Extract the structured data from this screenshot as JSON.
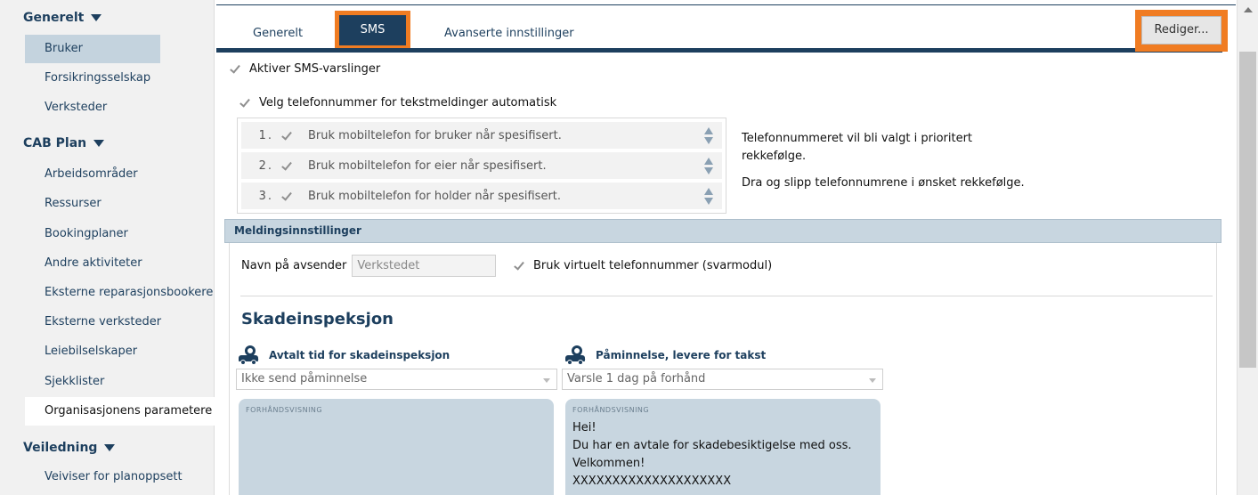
{
  "sidebar": {
    "groups": [
      {
        "label": "Generelt",
        "items": [
          "Bruker",
          "Forsikringsselskap",
          "Verksteder"
        ]
      },
      {
        "label": "CAB Plan",
        "items": [
          "Arbeidsområder",
          "Ressurser",
          "Bookingplaner",
          "Andre aktiviteter",
          "Eksterne reparasjonsbookere",
          "Eksterne verksteder",
          "Leiebilselskaper",
          "Sjekklister",
          "Organisasjonens parametere"
        ]
      },
      {
        "label": "Veiledning",
        "items": [
          "Veiviser for planoppsett"
        ]
      }
    ],
    "highlighted_item": "Bruker",
    "active_item": "Organisasjonens parametere"
  },
  "tabs": {
    "items": [
      "Generelt",
      "SMS",
      "Avanserte innstillinger"
    ],
    "active": "SMS"
  },
  "toolbar": {
    "edit_label": "Rediger..."
  },
  "sms": {
    "enable_label": "Aktiver SMS-varslinger",
    "auto_phone_label": "Velg telefonnummer for tekstmeldinger automatisk",
    "priority": [
      {
        "num": "1.",
        "label": "Bruk mobiltelefon for bruker når spesifisert."
      },
      {
        "num": "2.",
        "label": "Bruk mobiltelefon for eier når spesifisert."
      },
      {
        "num": "3.",
        "label": "Bruk mobiltelefon for holder når spesifisert."
      }
    ],
    "help_line1": "Telefonnummeret vil bli valgt i prioritert rekkefølge.",
    "help_line2": "Dra og slipp telefonnumrene i ønsket rekkefølge."
  },
  "message_settings": {
    "header": "Meldingsinnstillinger",
    "sender_label": "Navn på avsender",
    "sender_value": "Verkstedet",
    "virtual_label": "Bruk virtuelt telefonnummer (svarmodul)"
  },
  "damage_inspection": {
    "title": "Skadeinspeksjon",
    "columns": [
      {
        "label": "Avtalt tid for skadeinspeksjon",
        "select_value": "Ikke send påminnelse",
        "preview_label": "FORHÅNDSVISNING",
        "preview_text": ""
      },
      {
        "label": "Påminnelse, levere for takst",
        "select_value": "Varsle 1 dag på forhånd",
        "preview_label": "FORHÅNDSVISNING",
        "preview_text": "Hei!\nDu har en avtale for skadebesiktigelse med oss.\nVelkommen!\nXXXXXXXXXXXXXXXXXXXX"
      }
    ]
  },
  "colors": {
    "accent": "#1d3f5e",
    "highlight_orange": "#f07c22",
    "section_header_bg": "#c8d6e0"
  }
}
